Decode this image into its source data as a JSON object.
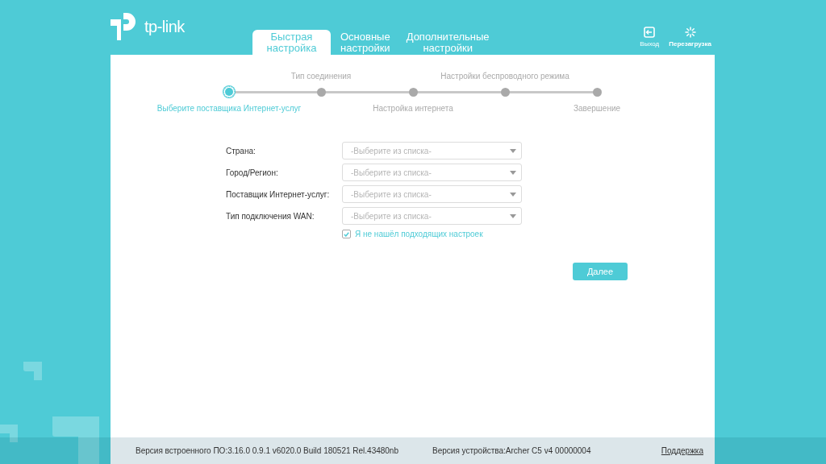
{
  "header": {
    "logo_text": "tp-link",
    "tabs": [
      {
        "label": "Быстрая настройка",
        "selected": true
      },
      {
        "label": "Основные настройки",
        "selected": false
      },
      {
        "label": "Дополнительные настройки",
        "selected": false
      }
    ],
    "actions": [
      {
        "label": "Выход",
        "kind": "logout"
      },
      {
        "label": "Перезагрузка",
        "kind": "reboot"
      }
    ]
  },
  "steps": [
    {
      "label": "Выберите поставщика Интернет-услуг",
      "selected": true
    },
    {
      "label": "Тип соединения",
      "selected": false
    },
    {
      "label": "Настройка интернета",
      "selected": false
    },
    {
      "label": "Настройки беспроводного режима",
      "selected": false
    },
    {
      "label": "Завершение",
      "selected": false
    }
  ],
  "form": {
    "fields": [
      {
        "label": "Страна:",
        "placeholder": "-Выберите из списка-"
      },
      {
        "label": "Город/Регион:",
        "placeholder": "-Выберите из списка-"
      },
      {
        "label": "Поставщик Интернет-услуг:",
        "placeholder": "-Выберите из списка-"
      },
      {
        "label": "Тип подключения WAN:",
        "placeholder": "-Выберите из списка-"
      }
    ],
    "checkbox": {
      "label": "Я не нашёл подходящих настроек",
      "checked": true
    },
    "next_button": "Далее"
  },
  "footer": {
    "firmware": "Версия встроенного ПО:3.16.0 0.9.1 v6020.0 Build 180521 Rel.43480nb",
    "hardware": "Версия устройства:Archer C5 v4 00000004",
    "support_link": "Поддержка"
  }
}
